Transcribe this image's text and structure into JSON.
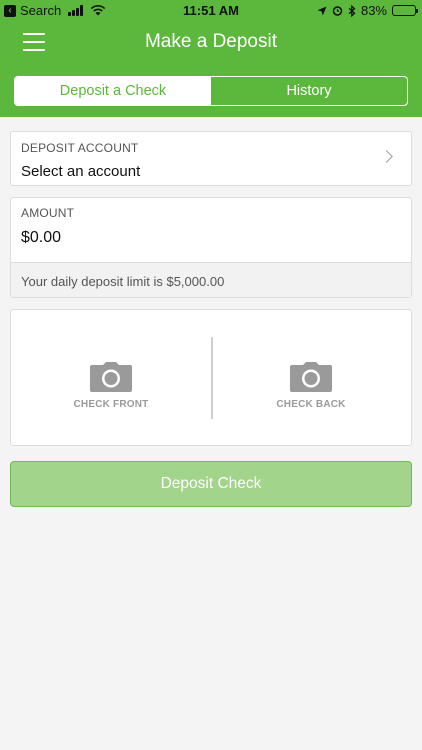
{
  "status_bar": {
    "back_label": "Search",
    "time": "11:51 AM",
    "battery": "83%",
    "battery_level": 0.83
  },
  "header": {
    "title": "Make a Deposit",
    "menu_icon": "hamburger-menu-icon"
  },
  "tabs": [
    {
      "label": "Deposit a Check",
      "active": true
    },
    {
      "label": "History",
      "active": false
    }
  ],
  "account": {
    "label": "DEPOSIT ACCOUNT",
    "value": "Select an account"
  },
  "amount": {
    "label": "AMOUNT",
    "value": "$0.00",
    "limit_note": "Your daily deposit limit is $5,000.00"
  },
  "capture": {
    "front_label": "CHECK FRONT",
    "back_label": "CHECK BACK"
  },
  "submit": {
    "label": "Deposit Check"
  },
  "colors": {
    "brand_green": "#5cb83c",
    "disabled_button": "#a2d48b",
    "background": "#f4f4f4"
  }
}
